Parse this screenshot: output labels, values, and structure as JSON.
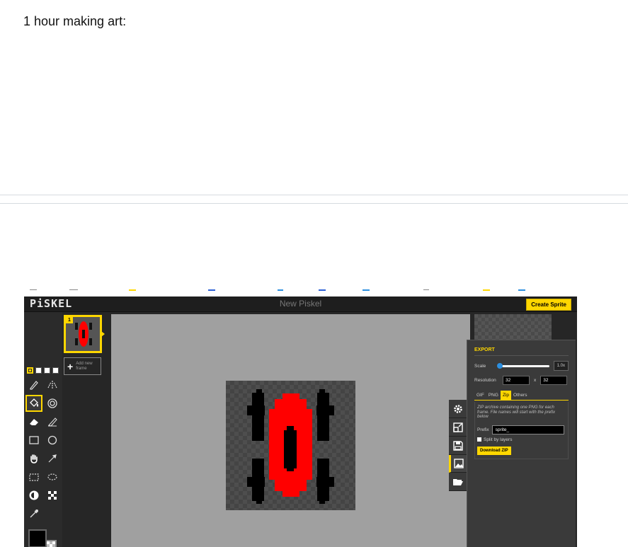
{
  "post": {
    "caption": "1 hour making art:"
  },
  "piskel": {
    "logo": "PiSKEL",
    "title": "New Piskel",
    "create_sprite": "Create Sprite",
    "frames": {
      "frame_number": "1",
      "add_frame": "Add new frame"
    },
    "tools": [
      "pen-tool",
      "vertical-mirror-pen",
      "paint-bucket",
      "paint-same-color",
      "eraser",
      "stroke",
      "rectangle",
      "circle",
      "move",
      "shape-selection",
      "rectangle-selection",
      "lasso-selection",
      "lighten",
      "dithering",
      "color-picker"
    ],
    "selected_tool": "paint-bucket",
    "colors": {
      "primary": "#000000",
      "secondary": "transparent",
      "sprite_red": "#ff0000",
      "accent": "#ffd700"
    },
    "export": {
      "title": "EXPORT",
      "scale_label": "Scale",
      "scale_value": "1.0x",
      "resolution_label": "Resolution",
      "width": "32",
      "times": "x",
      "height": "32",
      "tabs": [
        "GIF",
        "PNG",
        "Zip",
        "Others"
      ],
      "selected_tab": "Zip",
      "description": "ZIP archive containing one PNG for each frame. File names will start with the prefix below",
      "prefix_label": "Prefix",
      "prefix_value": "sprite_",
      "split_label": "Split by layers",
      "download_label": "Download ZIP"
    }
  }
}
